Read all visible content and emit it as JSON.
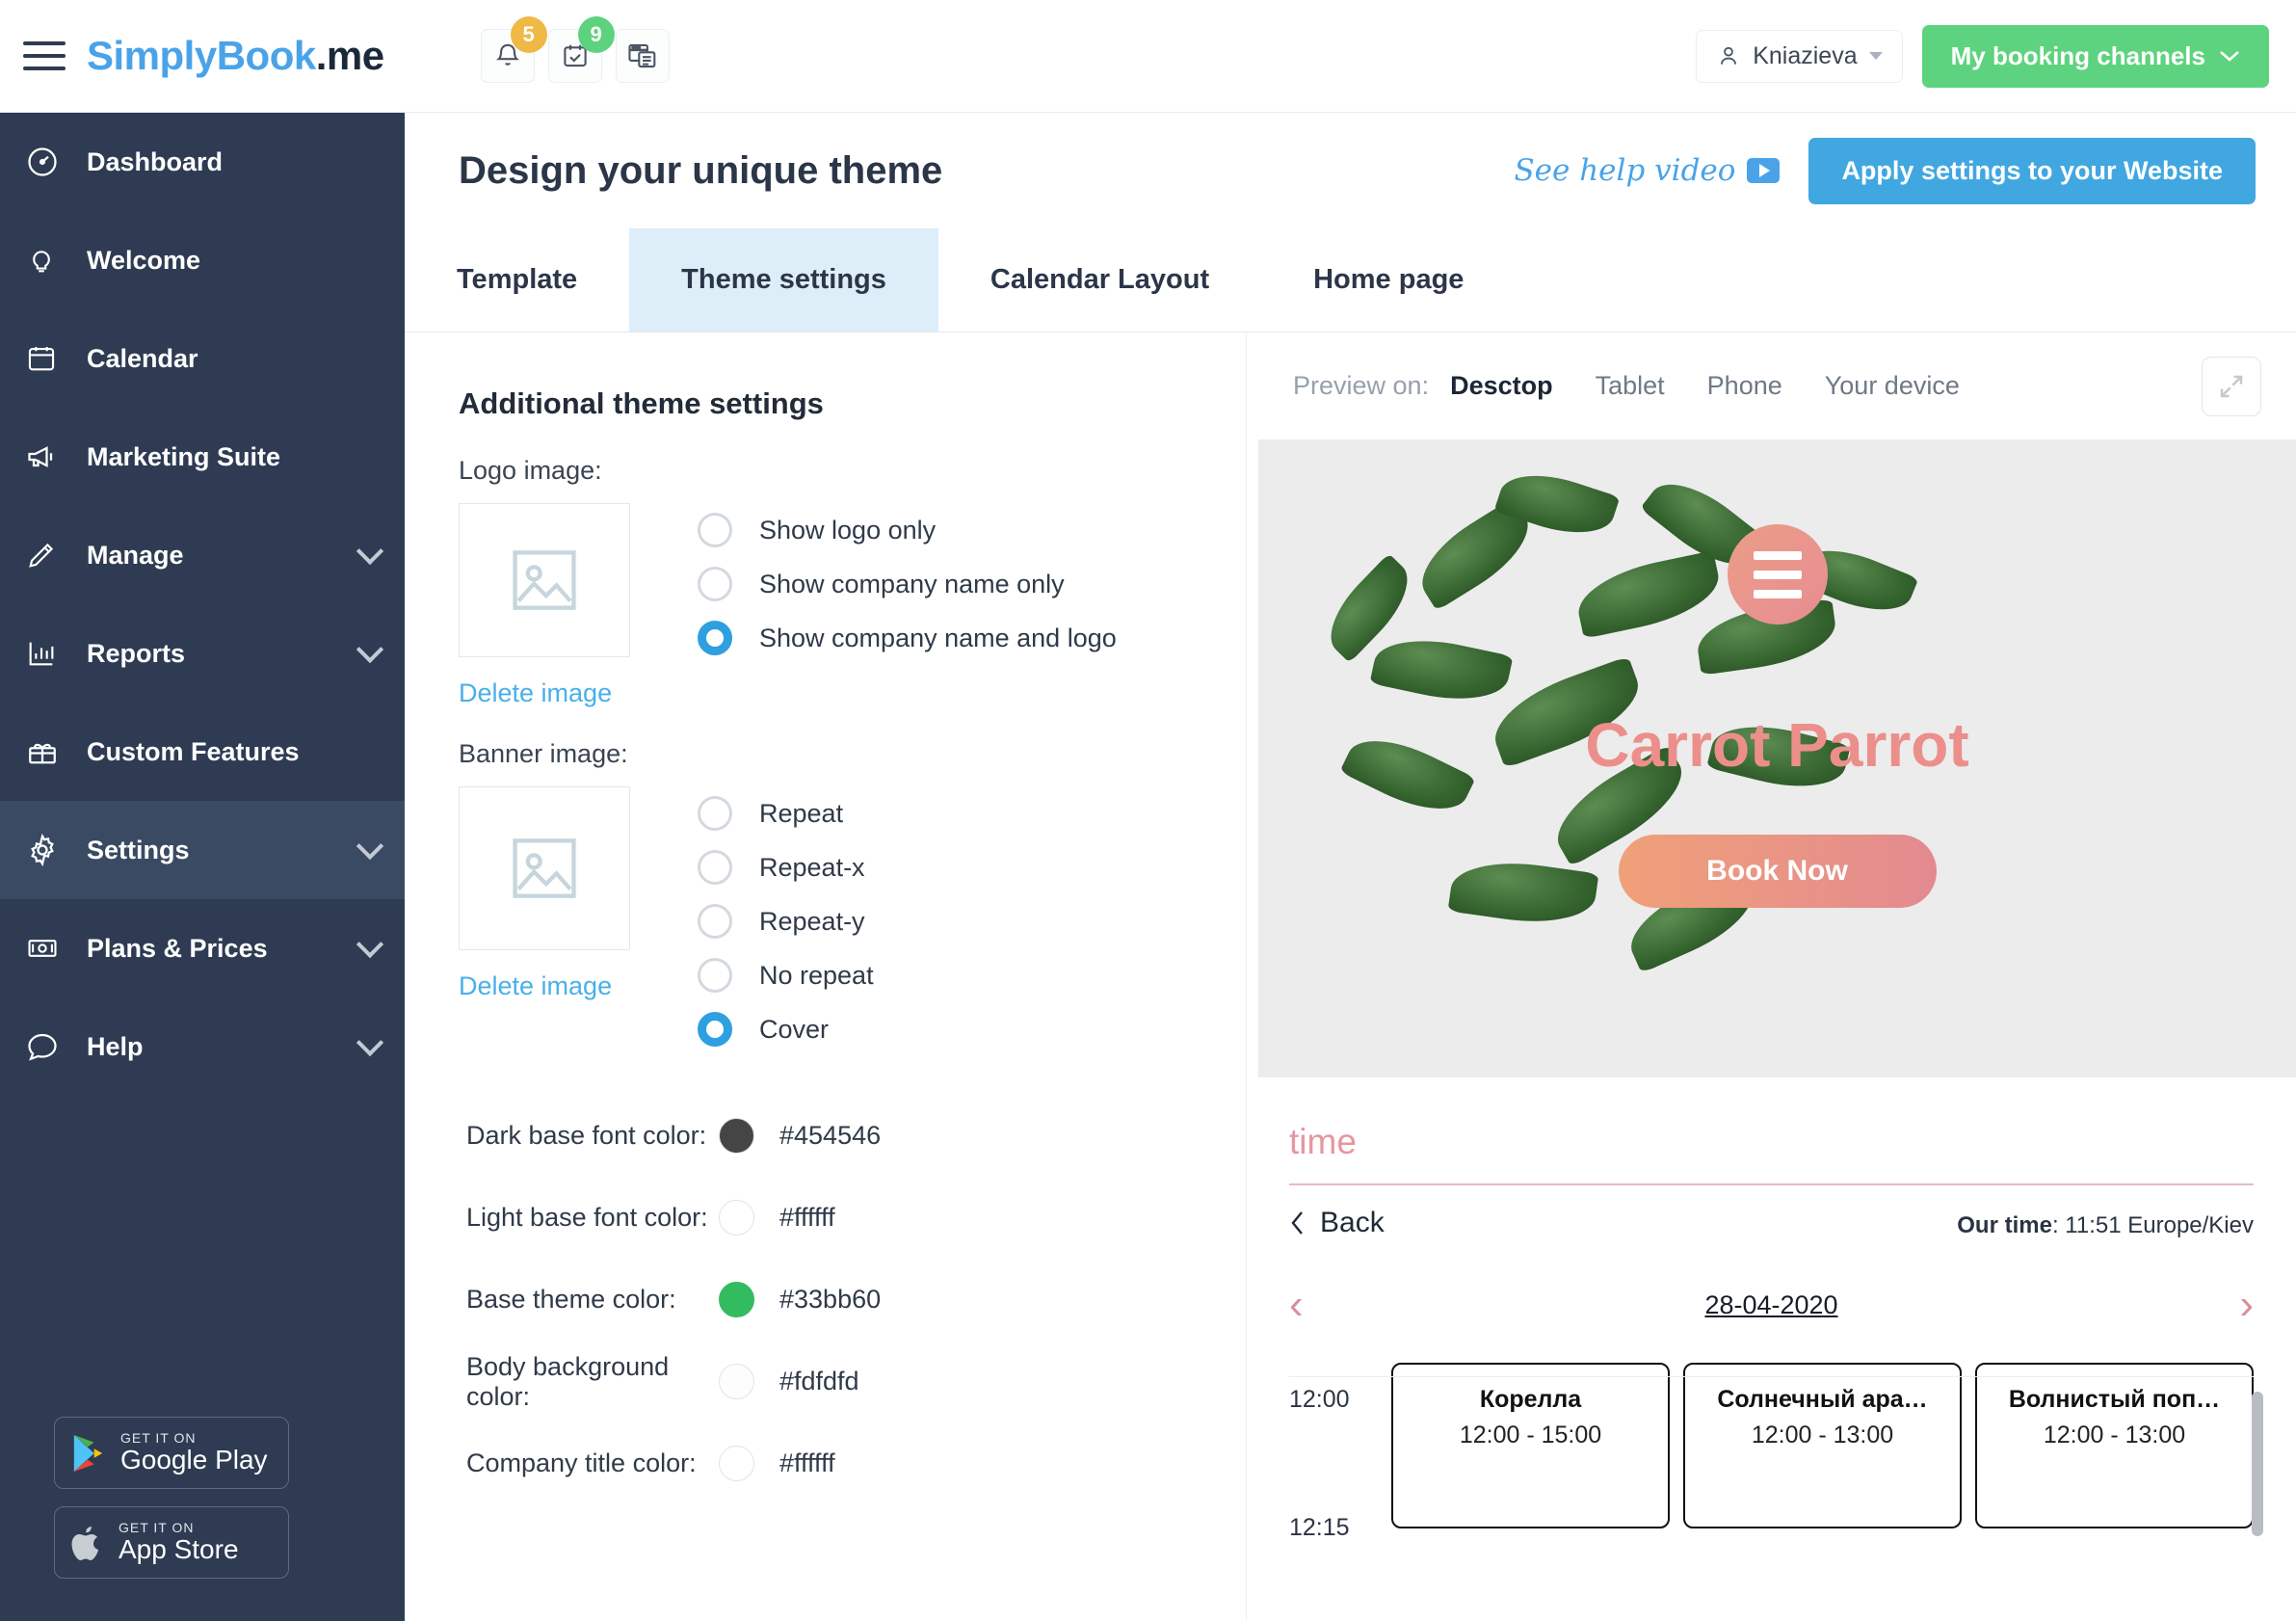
{
  "topbar": {
    "menu_icon": "hamburger-icon",
    "brand_blue": "implyBook",
    "brand_s": "S",
    "brand_dark": ".me",
    "icons": [
      {
        "name": "bell-icon",
        "badge": "5",
        "badge_color": "#f0b945"
      },
      {
        "name": "calendar-check-icon",
        "badge": "9",
        "badge_color": "#5ed37f"
      },
      {
        "name": "news-window-icon",
        "badge": ""
      }
    ],
    "user_name": "Kniazieva",
    "booking_channels_label": "My booking channels"
  },
  "sidebar": {
    "items": [
      {
        "label": "Dashboard",
        "icon": "gauge-icon",
        "expandable": false,
        "active": false
      },
      {
        "label": "Welcome",
        "icon": "lightbulb-icon",
        "expandable": false,
        "active": false
      },
      {
        "label": "Calendar",
        "icon": "calendar-icon",
        "expandable": false,
        "active": false
      },
      {
        "label": "Marketing Suite",
        "icon": "megaphone-icon",
        "expandable": false,
        "active": false
      },
      {
        "label": "Manage",
        "icon": "pencil-icon",
        "expandable": true,
        "active": false
      },
      {
        "label": "Reports",
        "icon": "bar-chart-icon",
        "expandable": true,
        "active": false
      },
      {
        "label": "Custom Features",
        "icon": "gift-icon",
        "expandable": false,
        "active": false
      },
      {
        "label": "Settings",
        "icon": "gear-icon",
        "expandable": true,
        "active": true
      },
      {
        "label": "Plans & Prices",
        "icon": "banknote-icon",
        "expandable": true,
        "active": false
      },
      {
        "label": "Help",
        "icon": "chat-bubble-icon",
        "expandable": true,
        "active": false
      }
    ],
    "store_badges": [
      {
        "small": "GET IT ON",
        "big": "Google Play",
        "icon": "google-play-icon"
      },
      {
        "small": "GET IT ON",
        "big": "App Store",
        "icon": "apple-icon"
      }
    ]
  },
  "page": {
    "title": "Design your unique theme",
    "help_video_label": "See help video",
    "apply_label": "Apply settings to your Website",
    "tabs": [
      {
        "label": "Template",
        "active": false
      },
      {
        "label": "Theme settings",
        "active": true
      },
      {
        "label": "Calendar Layout",
        "active": false
      },
      {
        "label": "Home page",
        "active": false
      }
    ]
  },
  "settings": {
    "section_title": "Additional theme settings",
    "logo": {
      "label": "Logo image:",
      "delete_label": "Delete image",
      "options": [
        {
          "label": "Show logo only",
          "checked": false
        },
        {
          "label": "Show company name only",
          "checked": false
        },
        {
          "label": "Show company name and logo",
          "checked": true
        }
      ]
    },
    "banner": {
      "label": "Banner image:",
      "delete_label": "Delete image",
      "options": [
        {
          "label": "Repeat",
          "checked": false
        },
        {
          "label": "Repeat-x",
          "checked": false
        },
        {
          "label": "Repeat-y",
          "checked": false
        },
        {
          "label": "No repeat",
          "checked": false
        },
        {
          "label": "Cover",
          "checked": true
        }
      ]
    },
    "colors": [
      {
        "label": "Dark base font color:",
        "value": "#454546",
        "swatch": "#454546"
      },
      {
        "label": "Light base font color:",
        "value": "#ffffff",
        "swatch": "#ffffff"
      },
      {
        "label": "Base theme color:",
        "value": "#33bb60",
        "swatch": "#33bb60"
      },
      {
        "label": "Body background color:",
        "value": "#fdfdfd",
        "swatch": "#fdfdfd"
      },
      {
        "label": "Company title color:",
        "value": "#ffffff",
        "swatch": "#ffffff"
      }
    ]
  },
  "preview": {
    "label": "Preview on:",
    "devices": [
      {
        "label": "Desctop",
        "active": true
      },
      {
        "label": "Tablet",
        "active": false
      },
      {
        "label": "Phone",
        "active": false
      },
      {
        "label": "Your device",
        "active": false
      }
    ],
    "expand_icon": "expand-arrows-icon",
    "hero": {
      "company_title": "Carrot Parrot",
      "book_now_label": "Book Now",
      "menu_icon": "hamburger-icon"
    },
    "booking": {
      "heading": "time",
      "back_label": "Back",
      "our_time_label": "Our time",
      "our_time_value": "11:51 Europe/Kiev",
      "date": "28-04-2020",
      "prev_arrow": "chevron-left-icon",
      "next_arrow": "chevron-right-icon",
      "hours": [
        "12:00",
        "12:15"
      ],
      "slots": [
        {
          "name": "Корелла",
          "time": "12:00 - 15:00"
        },
        {
          "name": "Солнечный ара…",
          "time": "12:00 - 13:00"
        },
        {
          "name": "Волнистый поп…",
          "time": "12:00 - 13:00"
        }
      ]
    }
  }
}
